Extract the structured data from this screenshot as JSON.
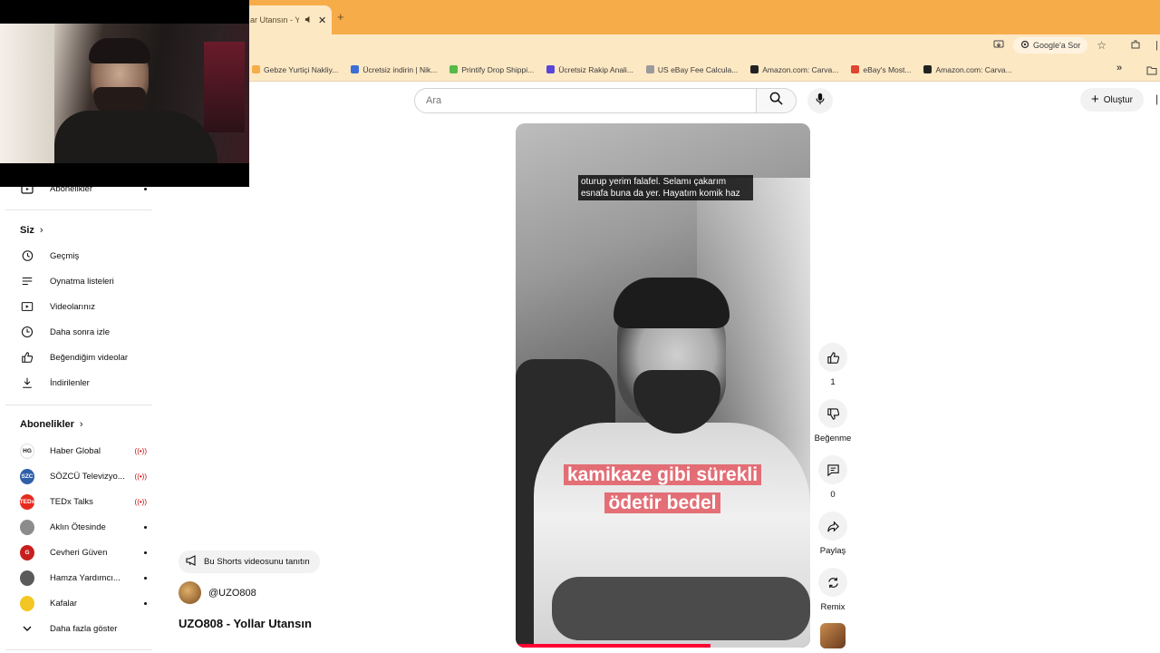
{
  "browser": {
    "active_tab_title": "ar Utansın - Y",
    "new_tab_symbol": "+",
    "toolbar": {
      "google_ask_label": "Google'a Sor"
    },
    "bookmarks": [
      {
        "label": "Gebze Yurtiçi Nakliy...",
        "color": "#f7ac4a"
      },
      {
        "label": "Ücretsiz indirin | Nik...",
        "color": "#3b6fd6"
      },
      {
        "label": "Printify Drop Shippi...",
        "color": "#57b947"
      },
      {
        "label": "Ücretsiz Rakip Anali...",
        "color": "#5a46d8"
      },
      {
        "label": "US eBay Fee Calcula...",
        "color": "#9a9a9a"
      },
      {
        "label": "Amazon.com: Carva...",
        "color": "#222222"
      },
      {
        "label": "eBay's Most...",
        "color": "#e0452f"
      },
      {
        "label": "Amazon.com: Carva...",
        "color": "#222222"
      }
    ]
  },
  "header": {
    "search_placeholder": "Ara",
    "create_label": "Oluştur"
  },
  "sidebar": {
    "partial_item": "Abonelikler",
    "you_section": {
      "title": "Siz",
      "items": [
        {
          "icon": "history-icon",
          "label": "Geçmiş"
        },
        {
          "icon": "playlist-icon",
          "label": "Oynatma listeleri"
        },
        {
          "icon": "your-videos-icon",
          "label": "Videolarınız"
        },
        {
          "icon": "watch-later-icon",
          "label": "Daha sonra izle"
        },
        {
          "icon": "liked-videos-icon",
          "label": "Beğendiğim videolar"
        },
        {
          "icon": "download-icon",
          "label": "İndirilenler"
        }
      ]
    },
    "subscriptions": {
      "title": "Abonelikler",
      "channels": [
        {
          "name": "Haber Global",
          "badge": "HG",
          "bg": "#ffffff",
          "fg": "#1a1a1a",
          "status": "live"
        },
        {
          "name": "SÖZCÜ Televizyo...",
          "badge": "SZC",
          "bg": "#2f5fa8",
          "fg": "#ffffff",
          "status": "live"
        },
        {
          "name": "TEDx Talks",
          "badge": "TEDx",
          "bg": "#e62b1e",
          "fg": "#ffffff",
          "status": "live"
        },
        {
          "name": "Aklın Ötesinde",
          "badge": "",
          "bg": "#8c8c8c",
          "fg": "#ffffff",
          "status": "new"
        },
        {
          "name": "Cevheri Güven",
          "badge": "G",
          "bg": "#c81e1e",
          "fg": "#ffffff",
          "status": "new"
        },
        {
          "name": "Hamza Yardımcı...",
          "badge": "",
          "bg": "#5a5a5a",
          "fg": "#ffffff",
          "status": "new"
        },
        {
          "name": "Kafalar",
          "badge": "",
          "bg": "#f3c623",
          "fg": "#222222",
          "status": "new"
        }
      ],
      "show_more_label": "Daha fazla göster"
    }
  },
  "video": {
    "caption_top": "oturup yerim falafel. Selamı çakarım esnafa buna da yer. Hayatım komik haz",
    "caption_big_line1": "kamikaze gibi sürekli",
    "caption_big_line2": "ödetir bedel",
    "progress_fraction": 0.66
  },
  "actions": {
    "like_count": "1",
    "dislike_label": "Beğenme",
    "comment_count": "0",
    "share_label": "Paylaş",
    "remix_label": "Remix"
  },
  "short_info": {
    "promote_label": "Bu Shorts videosunu tanıtın",
    "channel_handle": "@UZO808",
    "title": "UZO808 - Yollar Utansın"
  }
}
